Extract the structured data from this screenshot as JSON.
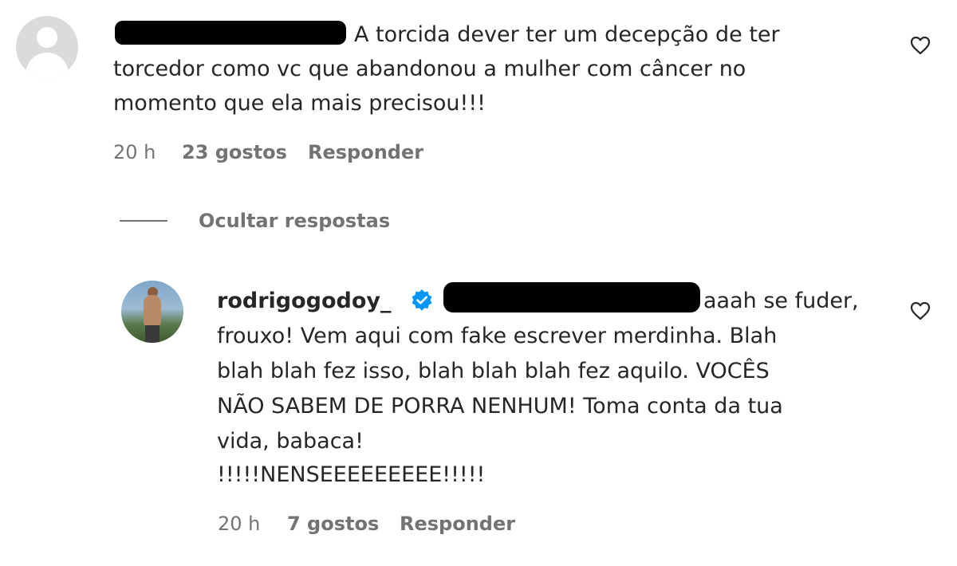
{
  "comment1": {
    "text_line1": "A torcida dever ter um decepção de ter",
    "text_line2": "torcedor como vc que abandonou a mulher com câncer no",
    "text_line3": "momento que ela mais precisou!!!",
    "time": "20 h",
    "likes": "23 gostos",
    "reply_label": "Responder",
    "like_icon": "heart-outline-icon"
  },
  "replies_toggle": {
    "label": "Ocultar respostas"
  },
  "comment2": {
    "username": "rodrigogodoy_",
    "verified_icon": "verified-badge-icon",
    "text_line1": "aaah se fuder,",
    "text_line2": "frouxo! Vem aqui com fake escrever merdinha. Blah",
    "text_line3": "blah blah fez isso, blah blah blah fez aquilo. VOCÊS",
    "text_line4": "NÃO SABEM DE PORRA NENHUM! Toma conta da tua",
    "text_line5": "vida, babaca!",
    "text_line6": "!!!!!NENSEEEEEEEEE!!!!!",
    "time": "20 h",
    "likes": "7 gostos",
    "reply_label": "Responder",
    "like_icon": "heart-outline-icon"
  },
  "colors": {
    "text": "#262626",
    "secondary": "#737373",
    "verified_blue": "#0095f6"
  }
}
